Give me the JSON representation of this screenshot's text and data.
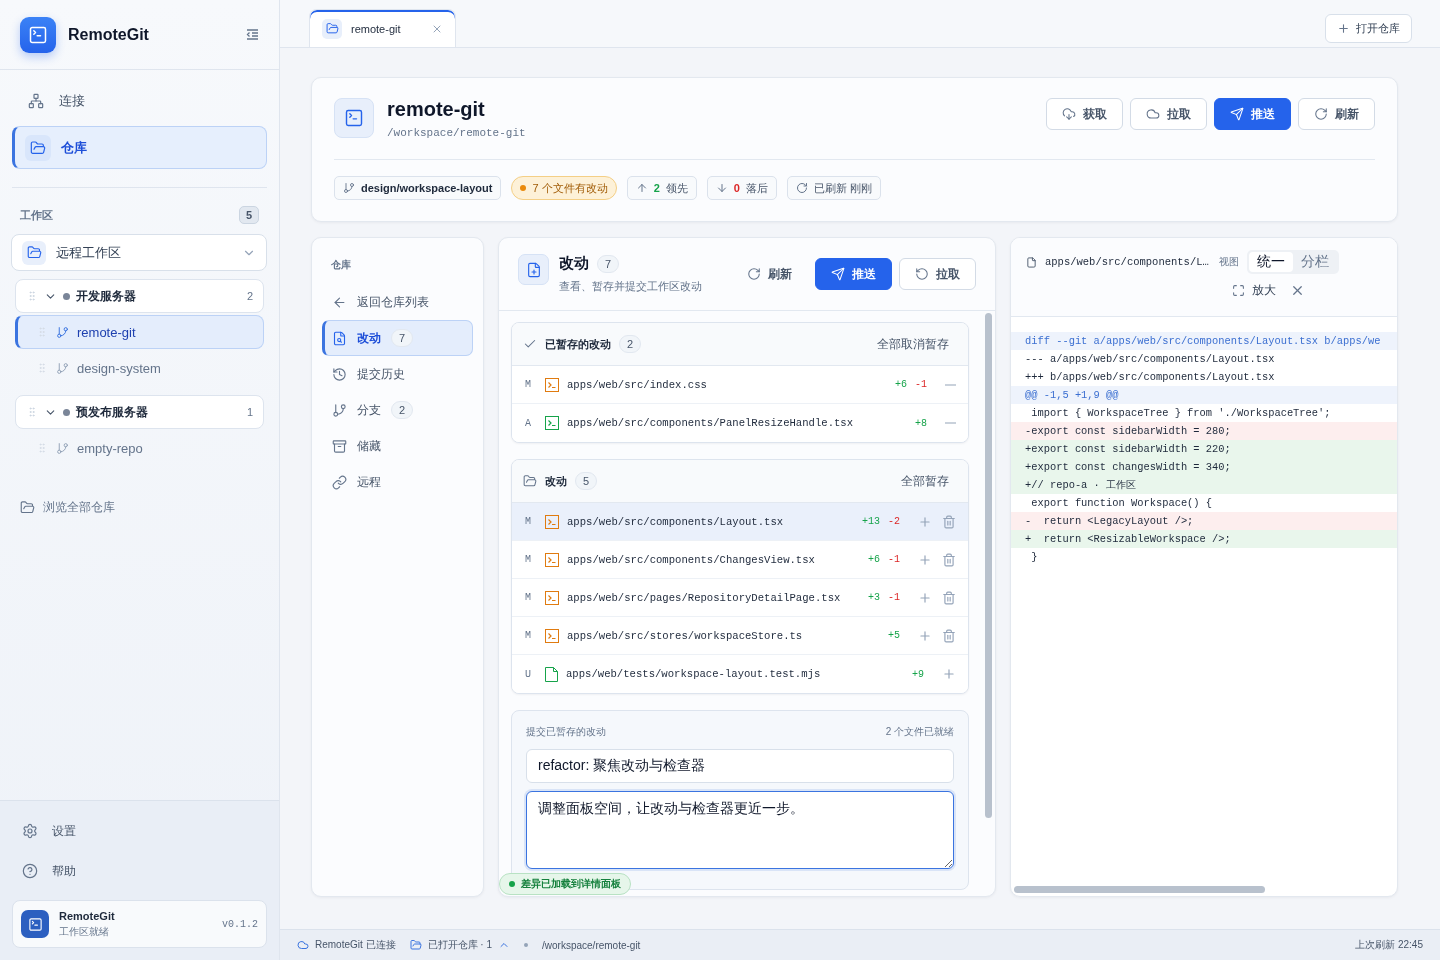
{
  "sidebar": {
    "app_name": "RemoteGit",
    "nav": [
      {
        "label": "连接",
        "selected": false
      },
      {
        "label": "仓库",
        "selected": true
      }
    ],
    "workspace_label": "工作区",
    "workspace_count": "5",
    "workspace_select": "远程工作区",
    "groups": [
      {
        "name": "开发服务器",
        "count": "2",
        "expanded": true,
        "children": [
          {
            "name": "remote-git",
            "selected": true
          },
          {
            "name": "design-system",
            "selected": false
          }
        ]
      },
      {
        "name": "预发布服务器",
        "count": "1",
        "expanded": true,
        "children": [
          {
            "name": "empty-repo",
            "selected": false
          }
        ]
      }
    ],
    "browse_all": "浏览全部仓库",
    "footer_links": [
      {
        "label": "设置"
      },
      {
        "label": "帮助"
      }
    ],
    "app_card": {
      "name": "RemoteGit",
      "status": "工作区就绪",
      "version": "v0.1.2"
    }
  },
  "tabs": [
    {
      "label": "remote-git",
      "selected": true
    }
  ],
  "open_repo_button": "打开仓库",
  "repo": {
    "name": "remote-git",
    "path": "/workspace/remote-git",
    "actions": [
      {
        "label": "获取",
        "kind": "outline"
      },
      {
        "label": "拉取",
        "kind": "outline"
      },
      {
        "label": "推送",
        "kind": "primary"
      },
      {
        "label": "刷新",
        "kind": "outline"
      }
    ],
    "chips": [
      {
        "kind": "branch",
        "text": "design/workspace-layout"
      },
      {
        "kind": "warning",
        "text": "7 个文件有改动"
      },
      {
        "kind": "ahead",
        "count": "2",
        "text": "领先"
      },
      {
        "kind": "behind",
        "count": "0",
        "text": "落后"
      },
      {
        "kind": "refresh",
        "text": "已刷新 刚刚"
      }
    ]
  },
  "repo_nav": {
    "title": "仓库",
    "items": [
      {
        "label": "返回仓库列表",
        "selected": false
      },
      {
        "label": "改动",
        "count": "7",
        "selected": true
      },
      {
        "label": "提交历史",
        "selected": false
      },
      {
        "label": "分支",
        "count": "2",
        "selected": false
      },
      {
        "label": "储藏",
        "selected": false
      },
      {
        "label": "远程",
        "selected": false
      }
    ]
  },
  "changes": {
    "title": "改动",
    "count": "7",
    "subtitle": "查看、暂存并提交工作区改动",
    "actions": [
      {
        "label": "刷新",
        "kind": "ghost"
      },
      {
        "label": "推送",
        "kind": "primary"
      },
      {
        "label": "拉取",
        "kind": "outline"
      }
    ],
    "sections": [
      {
        "kind": "staged",
        "title": "已暂存的改动",
        "count": "2",
        "action": "全部取消暂存",
        "files": [
          {
            "status": "M",
            "kind": "code",
            "color": "#e07b10",
            "path": "apps/web/src/index.css",
            "added": "+6",
            "removed": "-1",
            "selected": false
          },
          {
            "status": "A",
            "kind": "code",
            "color": "#16a34a",
            "path": "apps/web/src/components/PanelResizeHandle.tsx",
            "added": "+8",
            "selected": false
          }
        ]
      },
      {
        "kind": "unstaged",
        "title": "改动",
        "count": "5",
        "action": "全部暂存",
        "files": [
          {
            "status": "M",
            "kind": "code",
            "color": "#e07b10",
            "path": "apps/web/src/components/Layout.tsx",
            "added": "+13",
            "removed": "-2",
            "selected": true
          },
          {
            "status": "M",
            "kind": "code",
            "color": "#e07b10",
            "path": "apps/web/src/components/ChangesView.tsx",
            "added": "+6",
            "removed": "-1",
            "selected": false
          },
          {
            "status": "M",
            "kind": "code",
            "color": "#e07b10",
            "path": "apps/web/src/pages/RepositoryDetailPage.tsx",
            "added": "+3",
            "removed": "-1",
            "selected": false
          },
          {
            "status": "M",
            "kind": "code",
            "color": "#e07b10",
            "path": "apps/web/src/stores/workspaceStore.ts",
            "added": "+5",
            "selected": false
          },
          {
            "status": "U",
            "kind": "plain",
            "color": "#16a34a",
            "path": "apps/web/tests/workspace-layout.test.mjs",
            "added": "+9",
            "selected": false
          }
        ]
      }
    ],
    "commit": {
      "title": "提交已暂存的改动",
      "ready": "2 个文件已就绪",
      "summary": "refactor: 聚焦改动与检查器",
      "description": "调整面板空间，让改动与检查器更近一步。",
      "focused": true
    },
    "toast": "差异已加载到详情面板"
  },
  "diff": {
    "file": "apps/web/src/components/L…",
    "view_label": "视图",
    "view_options": [
      {
        "label": "统一",
        "selected": true
      },
      {
        "label": "分栏",
        "selected": false
      }
    ],
    "expand": "放大",
    "lines": [
      {
        "kind": "meta",
        "text": "diff --git a/apps/web/src/components/Layout.tsx b/apps/we"
      },
      {
        "kind": "header",
        "text": "--- a/apps/web/src/components/Layout.tsx"
      },
      {
        "kind": "header",
        "text": "+++ b/apps/web/src/components/Layout.tsx"
      },
      {
        "kind": "hunk",
        "text": "@@ -1,5 +1,9 @@"
      },
      {
        "kind": "context",
        "text": " import { WorkspaceTree } from './WorkspaceTree';"
      },
      {
        "kind": "del",
        "text": "-export const sidebarWidth = 280;"
      },
      {
        "kind": "add",
        "text": "+export const sidebarWidth = 220;"
      },
      {
        "kind": "add",
        "text": "+export const changesWidth = 340;"
      },
      {
        "kind": "add",
        "text": "+// repo-a · 工作区"
      },
      {
        "kind": "context",
        "text": " export function Workspace() {"
      },
      {
        "kind": "del",
        "text": "-  return <LegacyLayout />;"
      },
      {
        "kind": "add",
        "text": "+  return <ResizableWorkspace />;"
      },
      {
        "kind": "context",
        "text": " }"
      }
    ]
  },
  "status_bar": {
    "connection": "RemoteGit 已连接",
    "open_repos": "已打开仓库 · 1",
    "path": "/workspace/remote-git",
    "refreshed": "上次刷新 22:45"
  }
}
